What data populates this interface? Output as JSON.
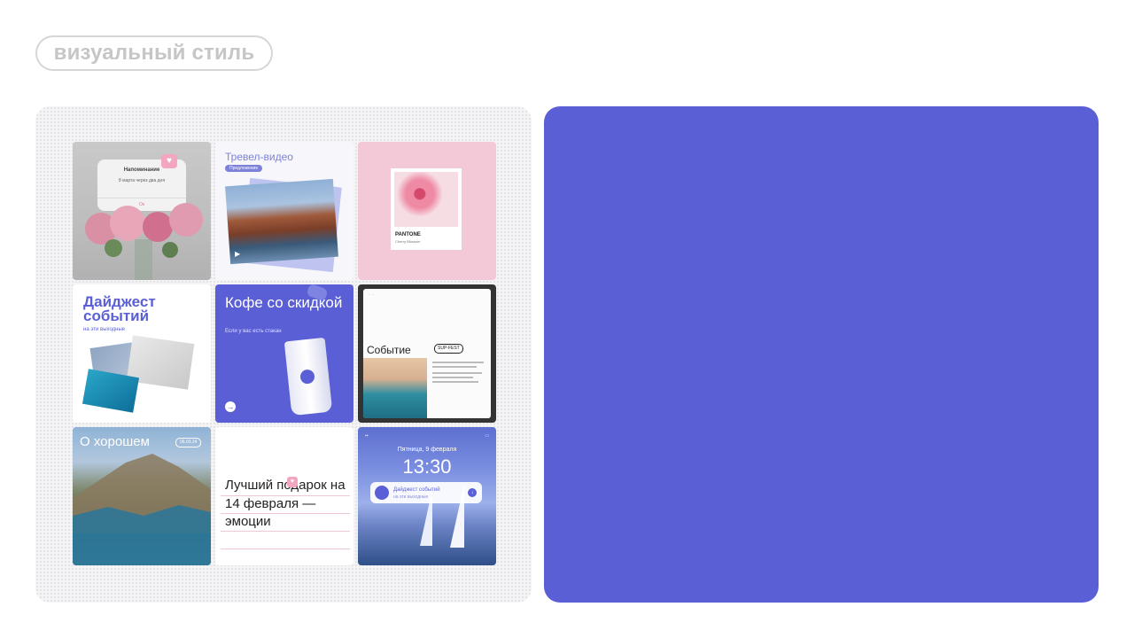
{
  "header": {
    "pill_label": "визуальный стиль"
  },
  "tiles": {
    "reminder": {
      "title": "Напоминание",
      "subtitle": "8 марта через два дня",
      "button": "Ок"
    },
    "travel": {
      "title": "Тревел-видео",
      "tag": "Предложение",
      "play": "▶"
    },
    "pantone": {
      "label": "PANTONE",
      "sub": "Cherry Blossom"
    },
    "digest": {
      "title": "Дайджест событий",
      "sub": "на эти выходные"
    },
    "coffee": {
      "title": "Кофе со скидкой",
      "sub": "Если у вас есть стакан"
    },
    "event": {
      "title": "Событие",
      "badge": "SUP-FEST"
    },
    "good": {
      "title": "О хорошем",
      "date": "06.03.24"
    },
    "gift": {
      "text": "Лучший подарок на 14 февраля — эмоции"
    },
    "lockscreen": {
      "day": "Пятница, 9 февраля",
      "time": "13:30",
      "notif_title": "Дайджест событий",
      "notif_sub": "на эти выходные"
    }
  },
  "colors": {
    "accent": "#5a5fd6",
    "pink": "#f3c9d8",
    "pill_text": "#c6c6c6"
  },
  "icons": [
    "heart-icon",
    "play-icon",
    "arrow-right-icon",
    "download-icon"
  ]
}
